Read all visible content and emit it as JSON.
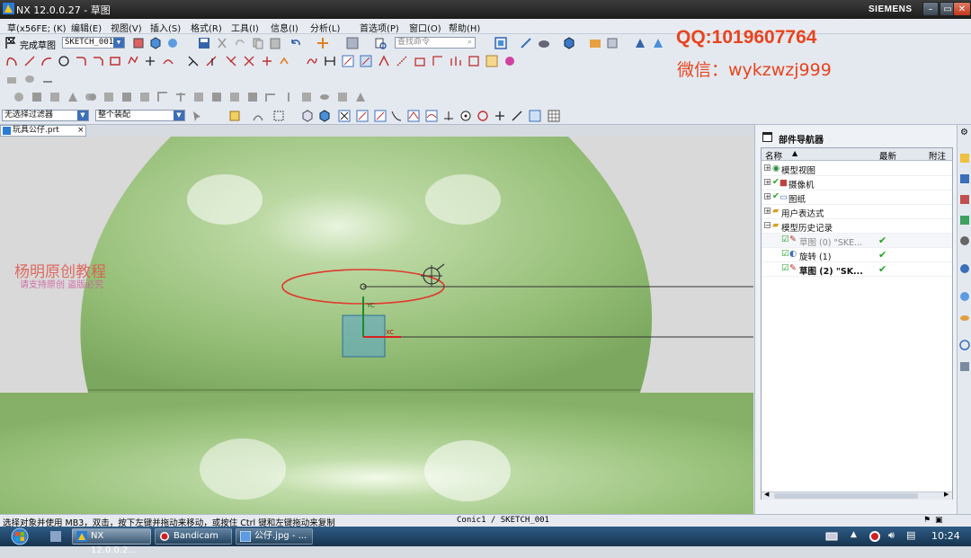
{
  "window": {
    "title": "NX 12.0.0.27 - 草图",
    "brand": "SIEMENS",
    "btn_min": "–",
    "btn_max": "▭",
    "btn_close": "✕"
  },
  "menu": [
    "草(x56FE; (K)",
    "编辑(E)",
    "视图(V)",
    "插入(S)",
    "格式(R)",
    "工具(I)",
    "信息(I)",
    "分析(L)",
    "首选项(P)",
    "窗口(O)",
    "帮助(H)"
  ],
  "sketch_toolbar": {
    "finish_label": "完成草图",
    "sketch_name": "SKETCH_001",
    "search_placeholder": "查找命令"
  },
  "filter_toolbar": {
    "selection_filter": "无选择过滤器",
    "assembly_scope": "整个装配"
  },
  "overlay": {
    "qq": "QQ:1019607764",
    "wechat": "微信：wykzwzj999"
  },
  "doc_tab": {
    "label": "玩具公仔.prt",
    "close": "×"
  },
  "viewport": {
    "watermark_title": "杨明原创教程",
    "watermark_sub": "请支持原创 盗版必究",
    "axis_yc": "YC",
    "axis_xc": "XC",
    "model_color": "#9ec27e"
  },
  "part_navigator": {
    "title": "部件导航器",
    "col_name": "名称",
    "col_latest": "最新",
    "col_note": "附注",
    "items": [
      {
        "label": "模型视图",
        "indent": 0,
        "expander": "+",
        "check": ""
      },
      {
        "label": "摄像机",
        "indent": 0,
        "expander": "+",
        "check": ""
      },
      {
        "label": "图纸",
        "indent": 0,
        "expander": "+",
        "check": ""
      },
      {
        "label": "用户表达式",
        "indent": 0,
        "expander": "+",
        "check": ""
      },
      {
        "label": "模型历史记录",
        "indent": 0,
        "expander": "−",
        "check": ""
      },
      {
        "label": "草图 (0) \"SKE...",
        "indent": 1,
        "expander": "",
        "check": "✔"
      },
      {
        "label": "旋转 (1)",
        "indent": 1,
        "expander": "",
        "check": "✔"
      },
      {
        "label": "草图 (2) \"SK...",
        "indent": 1,
        "expander": "",
        "check": "✔"
      }
    ]
  },
  "status": {
    "message": "选择对象并使用 MB3，双击，按下左键并拖动来移动，或按住 Ctrl 键和左键拖动来复制",
    "context": "Conic1 / SKETCH_001"
  },
  "taskbar": {
    "nx": "NX 12.0.0.2...",
    "bandicam": "Bandicam",
    "image": "公仔.jpg - ...",
    "clock": "10:24"
  }
}
